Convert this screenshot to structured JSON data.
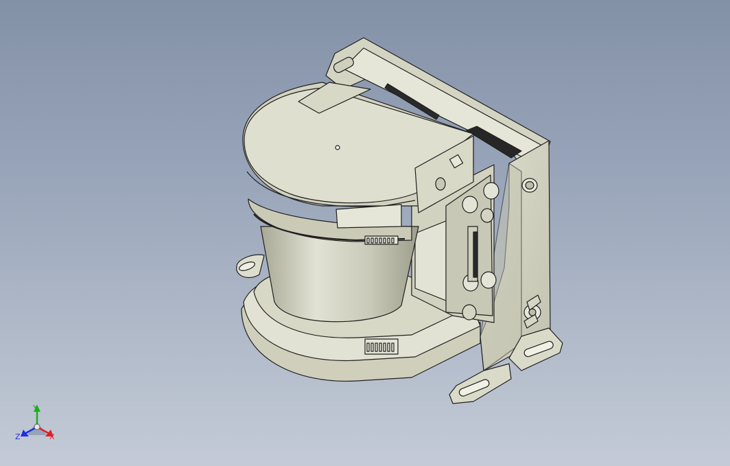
{
  "viewport": {
    "background_top": "#8391a7",
    "background_bottom": "#c4cbd7"
  },
  "model": {
    "body_color": "#d9d9c8",
    "shade_color": "#b7b7a4",
    "edge_color": "#1f1f1f",
    "dark_color": "#2a2a2a"
  },
  "triad": {
    "x_label": "X",
    "y_label": "Y",
    "z_label": "Z",
    "x_color": "#e02020",
    "y_color": "#18b018",
    "z_color": "#2030e0"
  }
}
